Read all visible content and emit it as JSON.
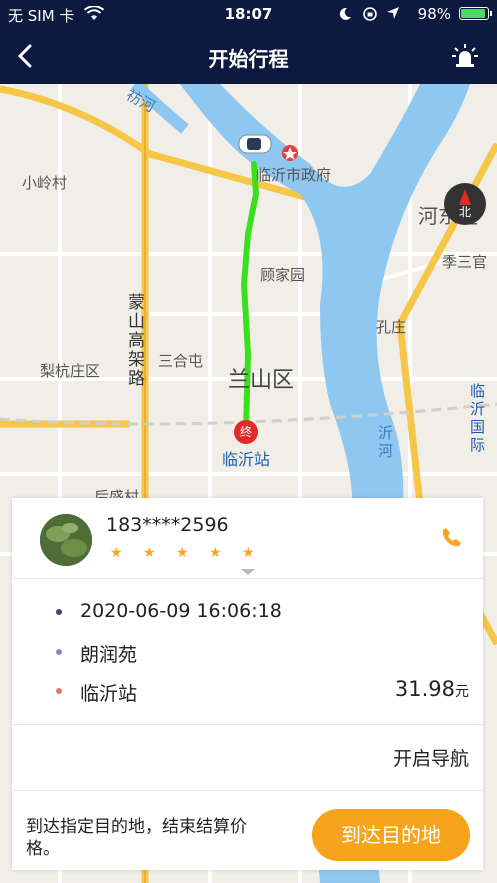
{
  "status": {
    "carrier": "无 SIM 卡",
    "time": "18:07",
    "battery": "98%",
    "battery_level": 0.98
  },
  "nav": {
    "title": "开始行程"
  },
  "map": {
    "labels": {
      "fang_he": "祊河",
      "xiaolingcun": "小岭村",
      "linyi_gov": "临沂市政府",
      "hedong": "河东区",
      "jisan": "季三官",
      "mengshan_road": "蒙山高架路",
      "gujiayuan": "顾家园",
      "kongzhuang": "孔庄",
      "lihangzhuang": "梨杭庄区",
      "sanhetun": "三合屯",
      "lanshan": "兰山区",
      "linyi_intl": "临沂国际",
      "linyi_station": "临沂站",
      "yi_he": "沂河",
      "hou_sheng": "后盛村",
      "end_marker": "终",
      "compass": "北"
    }
  },
  "driver": {
    "phone": "183****2596",
    "rating": 5
  },
  "trip": {
    "time": "2020-06-09 16:06:18",
    "origin": "朗润苑",
    "destination": "临沂站",
    "price": "31.98",
    "price_unit": "元",
    "navigate_label": "开启导航",
    "hint": "到达指定目的地，结束结算价格。",
    "arrive_label": "到达目的地"
  },
  "colors": {
    "nav_bg": "#0d1a3f",
    "accent": "#f7a31c",
    "route": "#39e01f",
    "river": "#8ec7f0"
  }
}
